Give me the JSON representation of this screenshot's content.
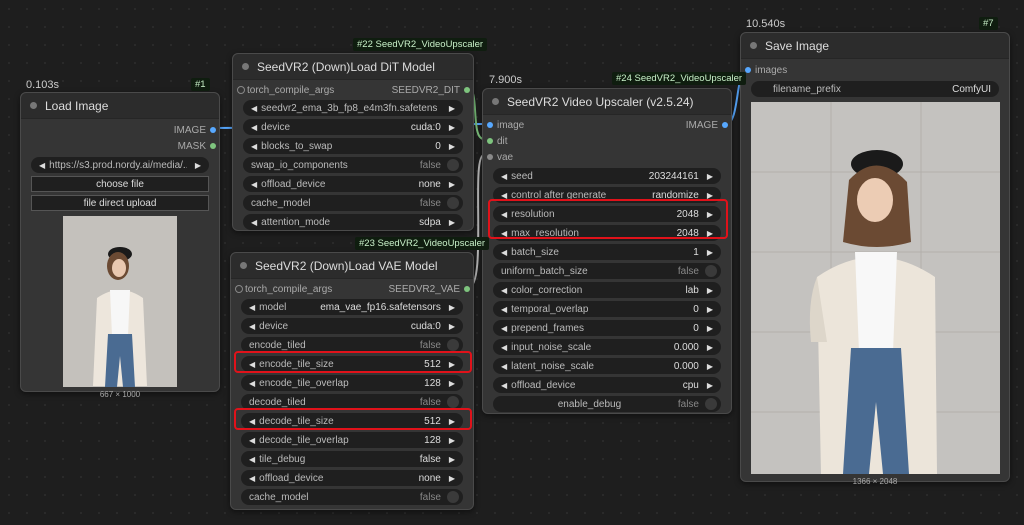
{
  "colors": {
    "canvas": "#1e1e1e",
    "node": "#353535",
    "highlight": "#e0121a",
    "image_link": "#57a8ff",
    "model_link": "#7ec47e"
  },
  "load_image": {
    "timing": "0.103s",
    "tag": "#1",
    "title": "Load Image",
    "outputs": [
      "IMAGE",
      "MASK"
    ],
    "url": "https://s3.prod.nordy.ai/media/...",
    "choose_file": "choose file",
    "direct_upload": "file direct upload",
    "dims": "667 × 1000"
  },
  "dit": {
    "tag": "#22 SeedVR2_VideoUpscaler",
    "title": "SeedVR2 (Down)Load DiT Model",
    "input": "torch_compile_args",
    "output": "SEEDVR2_DIT",
    "model": "seedvr2_ema_3b_fp8_e4m3fn.safetens ...",
    "rows": [
      {
        "label": "device",
        "value": "cuda:0"
      },
      {
        "label": "blocks_to_swap",
        "value": "0"
      },
      {
        "label": "swap_io_components",
        "value": "false"
      },
      {
        "label": "offload_device",
        "value": "none"
      },
      {
        "label": "cache_model",
        "value": "false"
      },
      {
        "label": "attention_mode",
        "value": "sdpa"
      }
    ]
  },
  "vae": {
    "tag": "#23 SeedVR2_VideoUpscaler",
    "title": "SeedVR2 (Down)Load VAE Model",
    "input": "torch_compile_args",
    "output": "SEEDVR2_VAE",
    "rows": [
      {
        "label": "model",
        "value": "ema_vae_fp16.safetensors"
      },
      {
        "label": "device",
        "value": "cuda:0"
      },
      {
        "label": "encode_tiled",
        "value": "false"
      },
      {
        "label": "encode_tile_size",
        "value": "512"
      },
      {
        "label": "encode_tile_overlap",
        "value": "128"
      },
      {
        "label": "decode_tiled",
        "value": "false"
      },
      {
        "label": "decode_tile_size",
        "value": "512"
      },
      {
        "label": "decode_tile_overlap",
        "value": "128"
      },
      {
        "label": "tile_debug",
        "value": "false"
      },
      {
        "label": "offload_device",
        "value": "none"
      },
      {
        "label": "cache_model",
        "value": "false"
      }
    ]
  },
  "upscaler": {
    "timing": "7.900s",
    "tag": "#24 SeedVR2_VideoUpscaler",
    "title": "SeedVR2 Video Upscaler (v2.5.24)",
    "inputs": [
      "image",
      "dit",
      "vae"
    ],
    "output": "IMAGE",
    "rows": [
      {
        "label": "seed",
        "value": "203244161"
      },
      {
        "label": "control after generate",
        "value": "randomize"
      },
      {
        "label": "resolution",
        "value": "2048"
      },
      {
        "label": "max_resolution",
        "value": "2048"
      },
      {
        "label": "batch_size",
        "value": "1"
      },
      {
        "label": "uniform_batch_size",
        "value": "false"
      },
      {
        "label": "color_correction",
        "value": "lab"
      },
      {
        "label": "temporal_overlap",
        "value": "0"
      },
      {
        "label": "prepend_frames",
        "value": "0"
      },
      {
        "label": "input_noise_scale",
        "value": "0.000"
      },
      {
        "label": "latent_noise_scale",
        "value": "0.000"
      },
      {
        "label": "offload_device",
        "value": "cpu"
      },
      {
        "label": "enable_debug",
        "value": "false"
      }
    ]
  },
  "save_image": {
    "timing": "10.540s",
    "tag": "#7",
    "title": "Save Image",
    "input": "images",
    "prefix_label": "filename_prefix",
    "prefix_value": "ComfyUI",
    "dims": "1366 × 2048"
  }
}
